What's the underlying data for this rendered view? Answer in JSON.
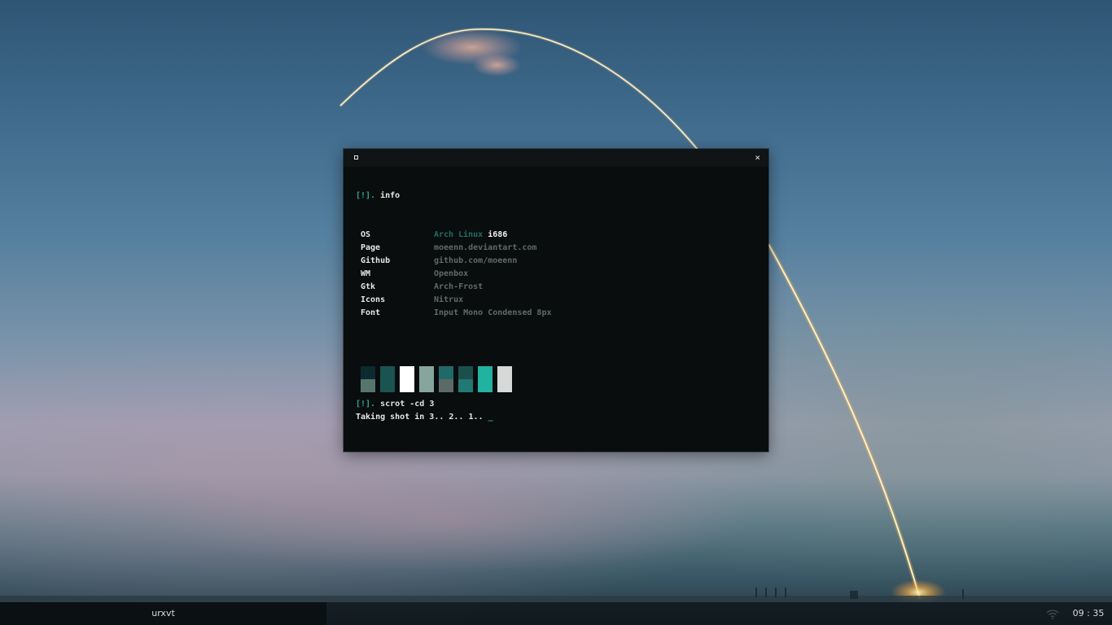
{
  "window": {
    "close_glyph": "×",
    "icon": "window-icon"
  },
  "terminal": {
    "prompt_mark": "[!].",
    "cmd1": "info",
    "info": [
      {
        "key": "OS",
        "value": "Arch Linux",
        "extra": "i686"
      },
      {
        "key": "Page",
        "value": "moeenn.deviantart.com"
      },
      {
        "key": "Github",
        "value": "github.com/moeenn"
      },
      {
        "key": "WM",
        "value": "Openbox"
      },
      {
        "key": "Gtk",
        "value": "Arch-Frost"
      },
      {
        "key": "Icons",
        "value": "Nitrux"
      },
      {
        "key": "Font",
        "value": "Input Mono Condensed 8px"
      }
    ],
    "palette": [
      {
        "top": "#0d2a30",
        "bottom": "#56766c"
      },
      {
        "top": "#1a5450",
        "bottom": "#1a5450"
      },
      {
        "top": "#ffffff",
        "bottom": "#ffffff"
      },
      {
        "top": "#86a59d",
        "bottom": "#86a59d"
      },
      {
        "top": "#1f6a69",
        "bottom": "#5b6a66"
      },
      {
        "top": "#1b4f4d",
        "bottom": "#227873"
      },
      {
        "top": "#21b3a0",
        "bottom": "#21b3a0"
      },
      {
        "top": "#d7d9d8",
        "bottom": "#d7d9d8"
      }
    ],
    "cmd2": "scrot -cd 3",
    "output": "Taking shot in 3.. 2.. 1..",
    "cursor": "_"
  },
  "taskbar": {
    "task_label": "urxvt",
    "tray_icon": "wifi-icon",
    "clock": "09 : 35"
  }
}
